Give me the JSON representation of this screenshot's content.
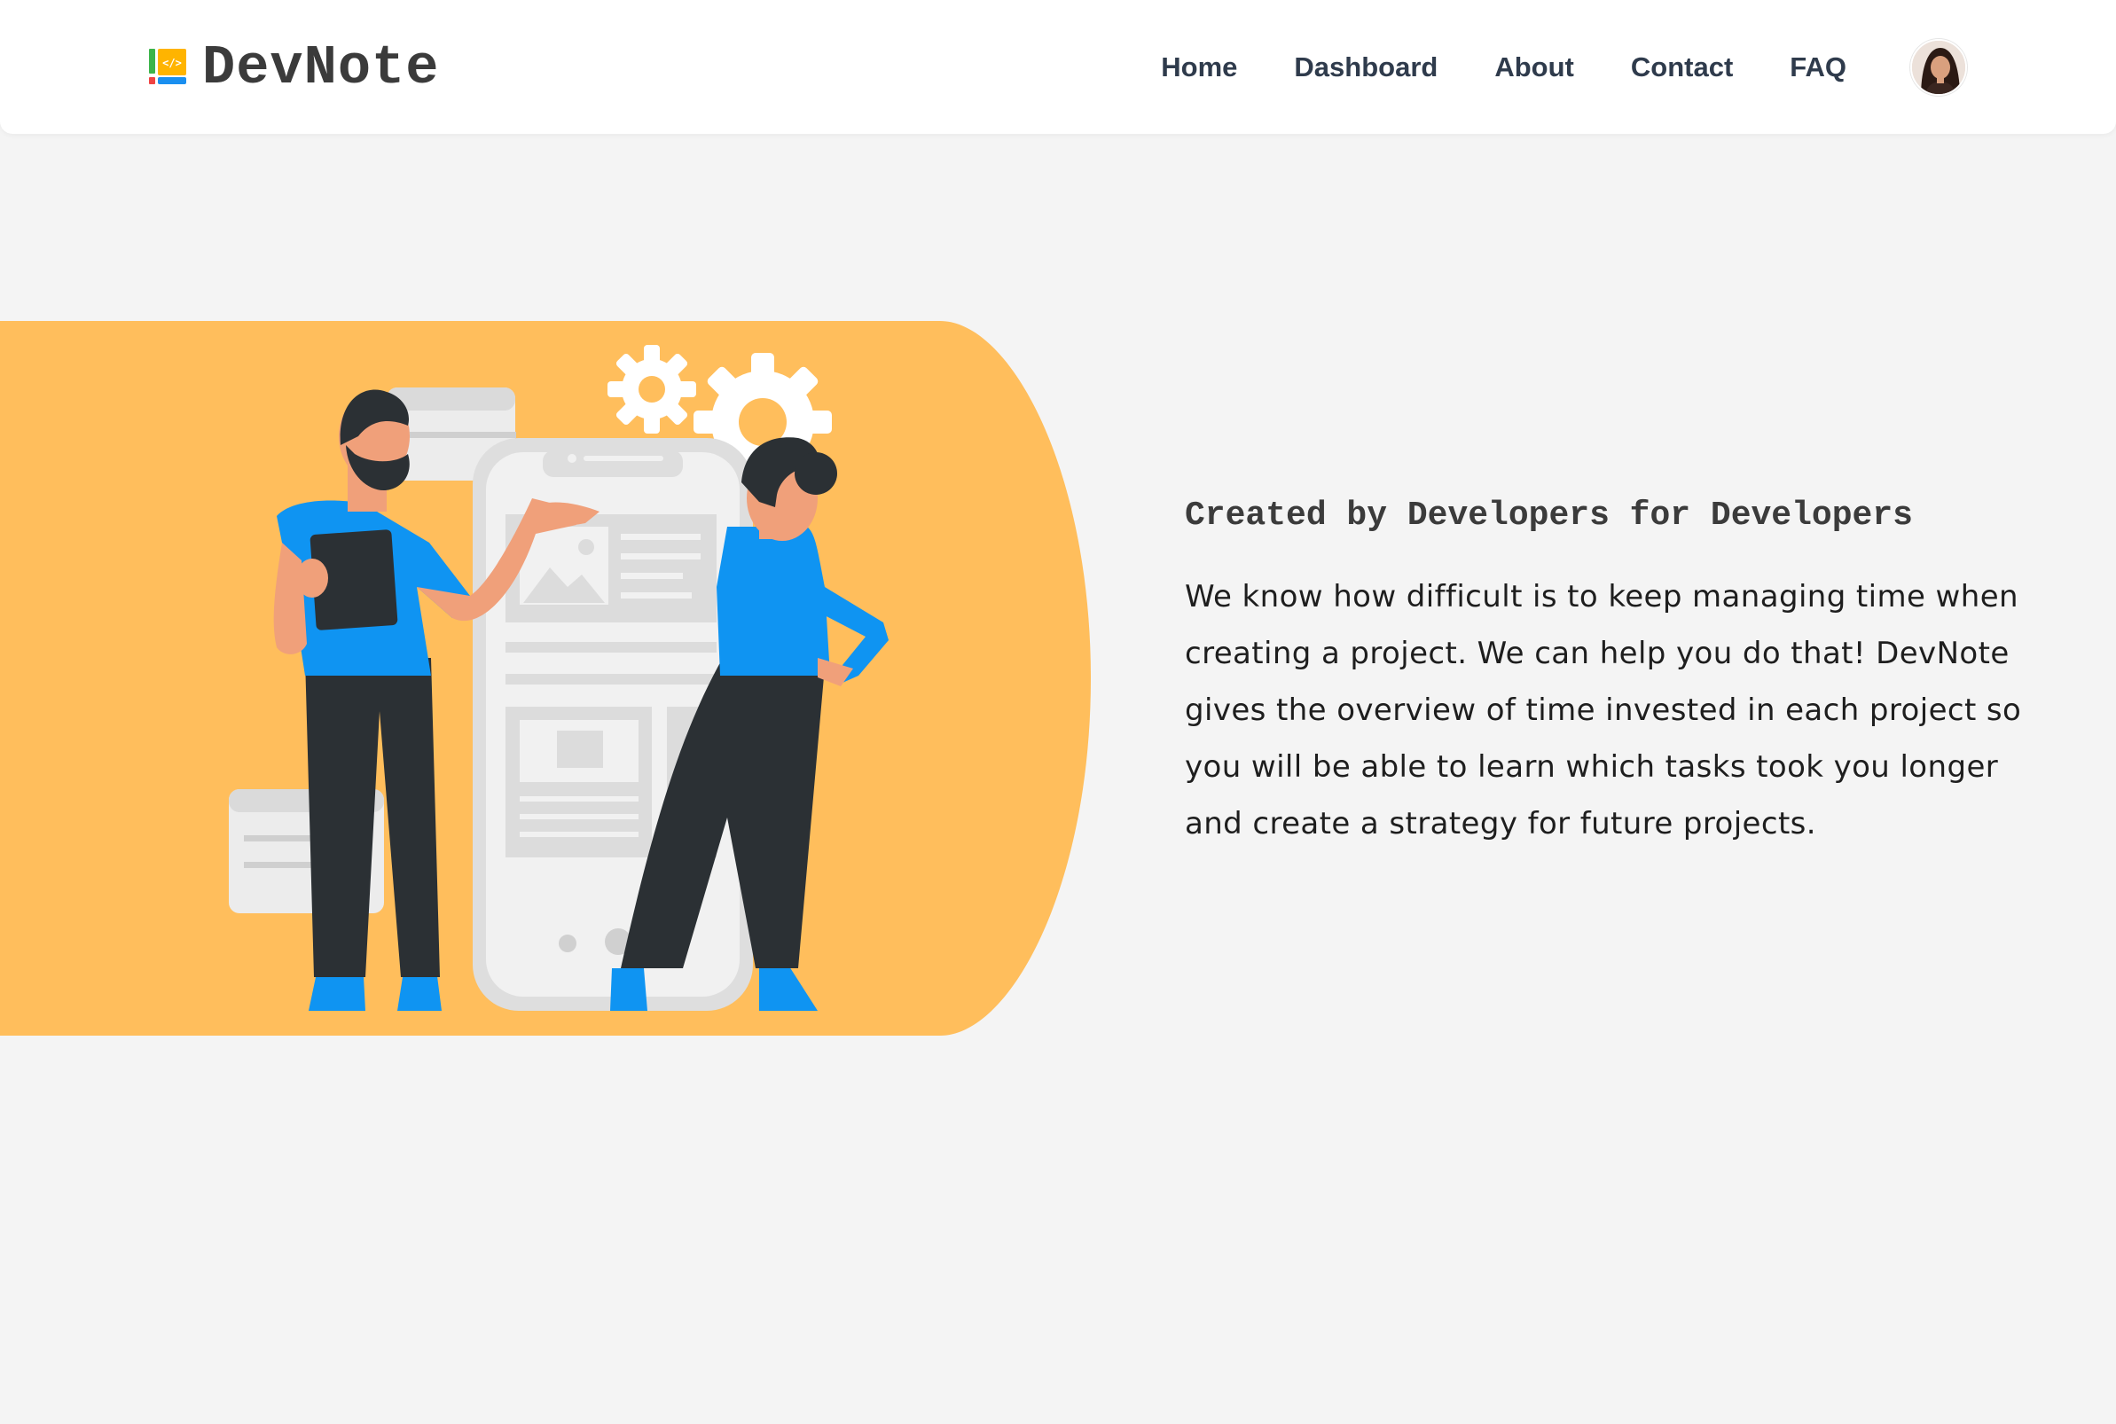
{
  "colors": {
    "hero_shape": "#ffbe5c",
    "accent_blue": "#0f94f2",
    "dark": "#2b3034",
    "skin": "#f0a07a",
    "nav_text": "#2f3b4c",
    "background": "#f4f4f4"
  },
  "navbar": {
    "brand": "DevNote",
    "logo_icon": "code-file-icon",
    "links": [
      "Home",
      "Dashboard",
      "About",
      "Contact",
      "FAQ"
    ],
    "avatar_icon": "user-avatar"
  },
  "hero": {
    "illustration": "developers-with-phone-illustration",
    "heading": "Created by Developers for Developers",
    "paragraph": "We know how difficult is to keep managing time when creating a project. We can help you do that! DevNote gives the overview of time invested in each project so you will be able to learn which tasks took you longer and create a strategy for future projects."
  }
}
